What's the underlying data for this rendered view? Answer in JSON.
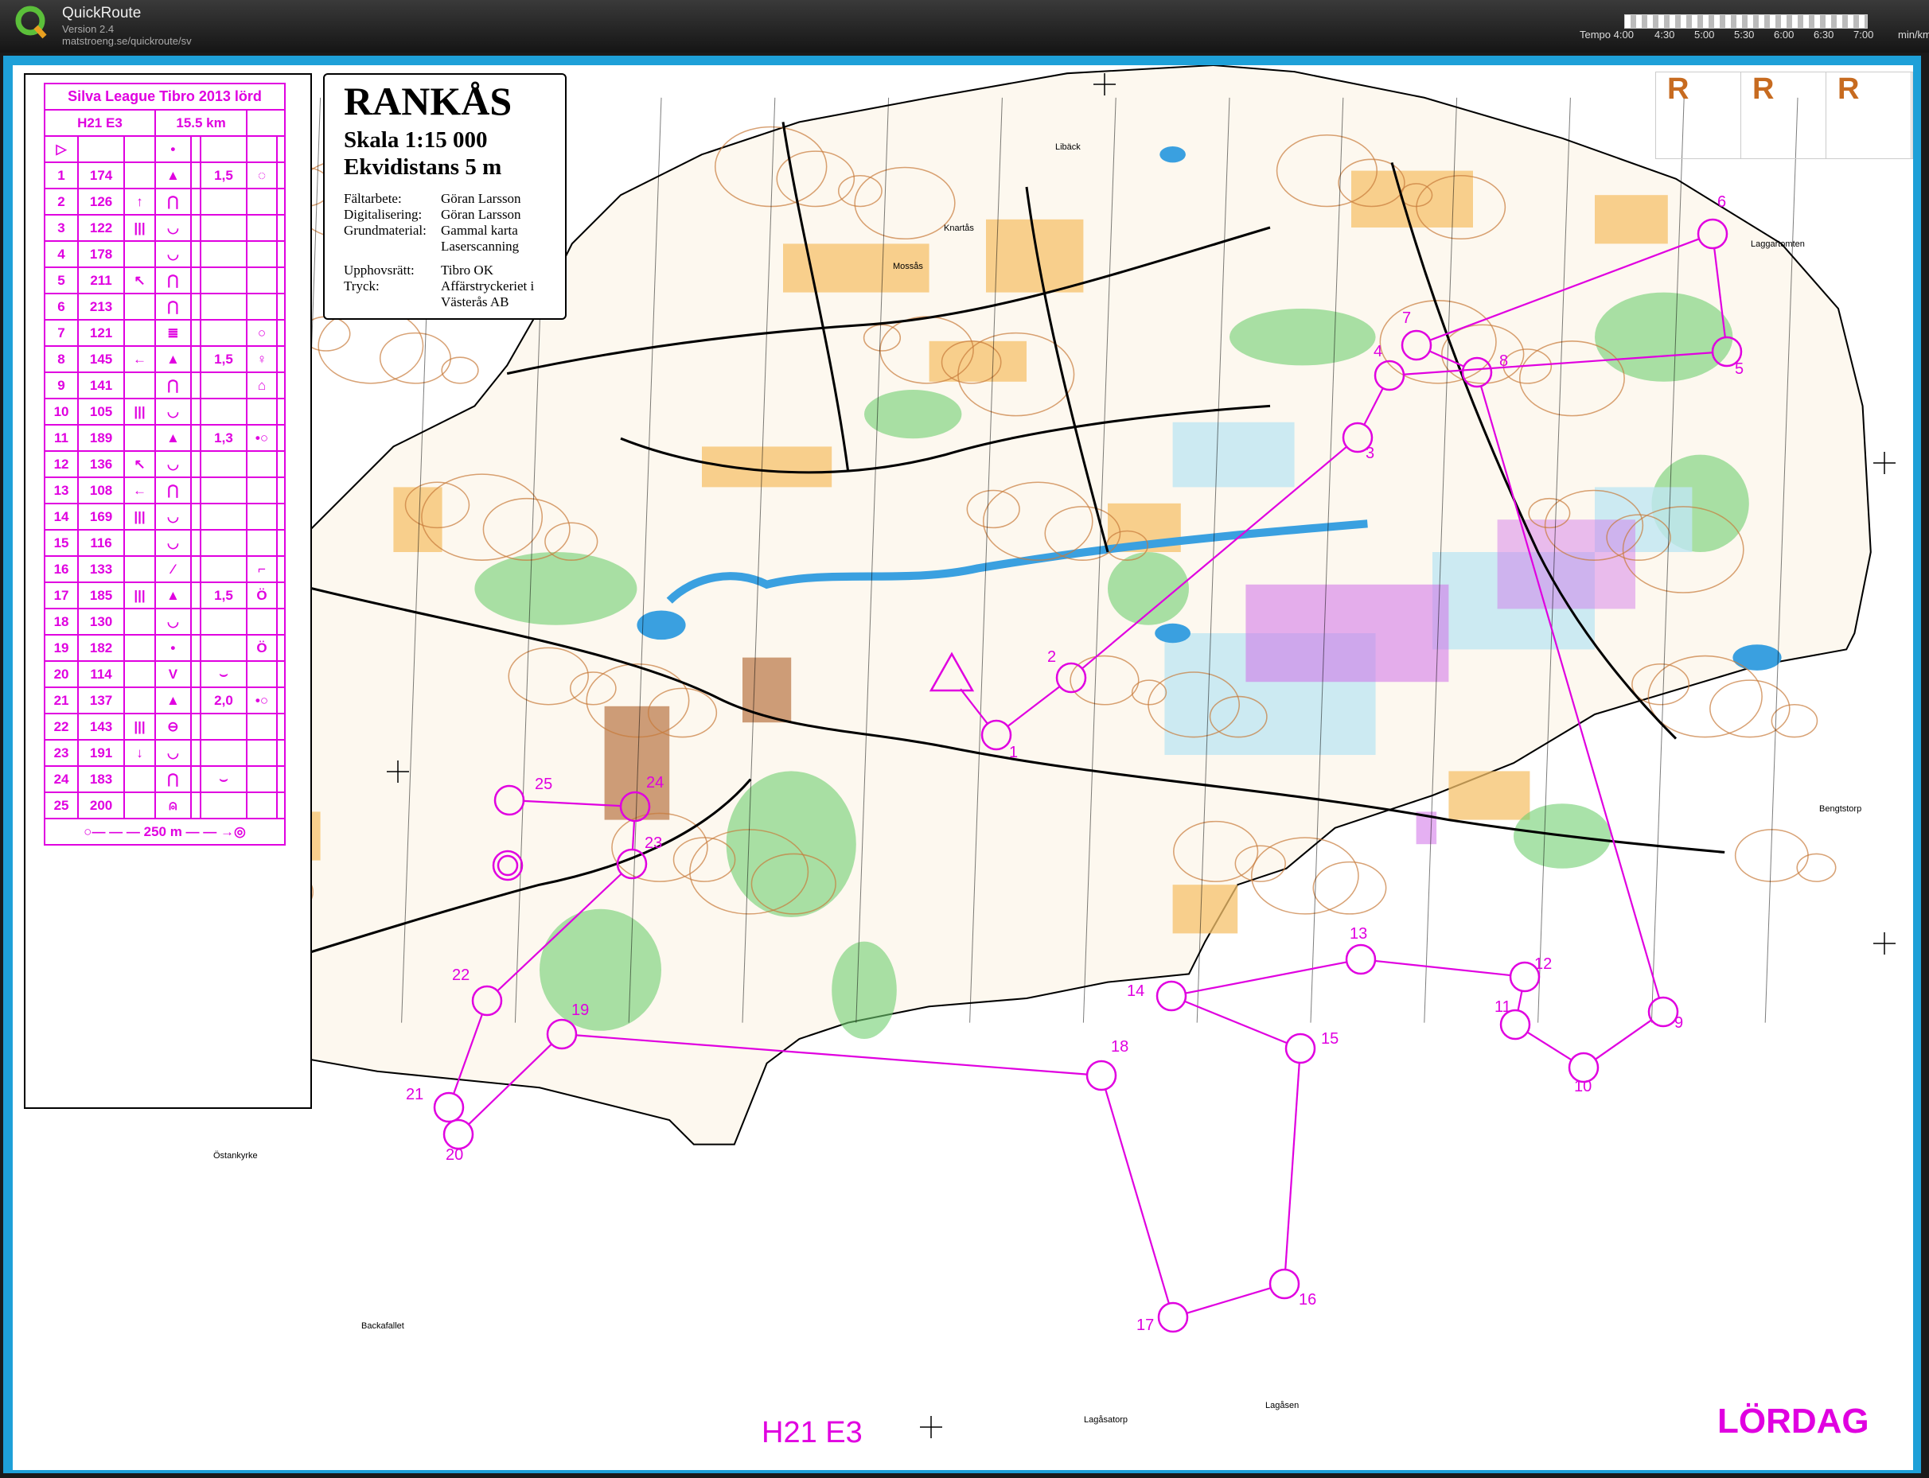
{
  "app": {
    "title": "QuickRoute",
    "version": "Version 2.4",
    "url": "matstroeng.se/quickroute/sv",
    "tempo_labels": [
      "Tempo 4:00",
      "4:30",
      "5:00",
      "5:30",
      "6:00",
      "6:30",
      "7:00",
      "min/km"
    ]
  },
  "map": {
    "title": "RANKÅS",
    "scale": "Skala 1:15 000",
    "contour": "Ekvidistans 5 m",
    "credits": [
      {
        "label": "Fältarbete:",
        "value": "Göran Larsson"
      },
      {
        "label": "Digitalisering:",
        "value": "Göran Larsson"
      },
      {
        "label": "Grundmaterial:",
        "value": "Gammal karta Laserscanning"
      },
      {
        "label": "Upphovsrätt:",
        "value": "Tibro OK"
      },
      {
        "label": "Tryck:",
        "value": "Affärstryckeriet i Västerås AB"
      }
    ],
    "class_label": "H21 E3",
    "day_label": "LÖRDAG",
    "r_marks": [
      "R",
      "R",
      "R"
    ],
    "place_names": [
      "Libäck",
      "Knartås",
      "Mossås",
      "Laggartomten",
      "Bengtstorp",
      "Östankyrke",
      "Backafallet",
      "Lagåsatorp",
      "Lagåsen"
    ],
    "colors": {
      "course": "#e000e0",
      "forest_open": "#f5c26b",
      "green": "#6fce6f",
      "water": "#3aa0e0",
      "contour": "#c87a3a",
      "frame": "#1ea0d8"
    }
  },
  "control_description": {
    "event": "Silva League Tibro 2013 lörd",
    "class": "H21 E3",
    "length": "15.5 km",
    "rows": [
      {
        "n": "1",
        "code": "174",
        "dir": "",
        "feature": "▲",
        "dim": "1,5",
        "extra": "◌"
      },
      {
        "n": "2",
        "code": "126",
        "dir": "↑",
        "feature": "⋂",
        "dim": "",
        "extra": ""
      },
      {
        "n": "3",
        "code": "122",
        "dir": "|||",
        "feature": "◡",
        "dim": "",
        "extra": ""
      },
      {
        "n": "4",
        "code": "178",
        "dir": "",
        "feature": "◡",
        "dim": "",
        "extra": ""
      },
      {
        "n": "5",
        "code": "211",
        "dir": "↖",
        "feature": "⋂",
        "dim": "",
        "extra": ""
      },
      {
        "n": "6",
        "code": "213",
        "dir": "",
        "feature": "⋂",
        "dim": "",
        "extra": ""
      },
      {
        "n": "7",
        "code": "121",
        "dir": "",
        "feature": "≣",
        "dim": "",
        "extra": "○"
      },
      {
        "n": "8",
        "code": "145",
        "dir": "←",
        "feature": "▲",
        "dim": "1,5",
        "extra": "♀"
      },
      {
        "n": "9",
        "code": "141",
        "dir": "",
        "feature": "⋂",
        "dim": "",
        "extra": "⌂"
      },
      {
        "n": "10",
        "code": "105",
        "dir": "|||",
        "feature": "◡",
        "dim": "",
        "extra": ""
      },
      {
        "n": "11",
        "code": "189",
        "dir": "",
        "feature": "▲",
        "dim": "1,3",
        "extra": "•○"
      },
      {
        "n": "12",
        "code": "136",
        "dir": "↖",
        "feature": "◡",
        "dim": "",
        "extra": ""
      },
      {
        "n": "13",
        "code": "108",
        "dir": "←",
        "feature": "⋂",
        "dim": "",
        "extra": ""
      },
      {
        "n": "14",
        "code": "169",
        "dir": "|||",
        "feature": "◡",
        "dim": "",
        "extra": ""
      },
      {
        "n": "15",
        "code": "116",
        "dir": "",
        "feature": "◡",
        "dim": "",
        "extra": ""
      },
      {
        "n": "16",
        "code": "133",
        "dir": "",
        "feature": "⁄",
        "dim": "",
        "extra": "⌐"
      },
      {
        "n": "17",
        "code": "185",
        "dir": "|||",
        "feature": "▲",
        "dim": "1,5",
        "extra": "Ö"
      },
      {
        "n": "18",
        "code": "130",
        "dir": "",
        "feature": "◡",
        "dim": "",
        "extra": ""
      },
      {
        "n": "19",
        "code": "182",
        "dir": "",
        "feature": "•",
        "dim": "",
        "extra": "Ö"
      },
      {
        "n": "20",
        "code": "114",
        "dir": "",
        "feature": "V",
        "dim": "⌣",
        "extra": ""
      },
      {
        "n": "21",
        "code": "137",
        "dir": "",
        "feature": "▲",
        "dim": "2,0",
        "extra": "•○"
      },
      {
        "n": "22",
        "code": "143",
        "dir": "|||",
        "feature": "⊖",
        "dim": "",
        "extra": ""
      },
      {
        "n": "23",
        "code": "191",
        "dir": "↓",
        "feature": "◡",
        "dim": "",
        "extra": ""
      },
      {
        "n": "24",
        "code": "183",
        "dir": "",
        "feature": "⋂",
        "dim": "⌣",
        "extra": ""
      },
      {
        "n": "25",
        "code": "200",
        "dir": "",
        "feature": "⍝",
        "dim": "",
        "extra": ""
      }
    ],
    "finish": "250 m"
  },
  "course": {
    "controls": [
      {
        "n": "1"
      },
      {
        "n": "2"
      },
      {
        "n": "3"
      },
      {
        "n": "4"
      },
      {
        "n": "5"
      },
      {
        "n": "6"
      },
      {
        "n": "7"
      },
      {
        "n": "8"
      },
      {
        "n": "9"
      },
      {
        "n": "10"
      },
      {
        "n": "11"
      },
      {
        "n": "12"
      },
      {
        "n": "13"
      },
      {
        "n": "14"
      },
      {
        "n": "15"
      },
      {
        "n": "16"
      },
      {
        "n": "17"
      },
      {
        "n": "18"
      },
      {
        "n": "19"
      },
      {
        "n": "20"
      },
      {
        "n": "21"
      },
      {
        "n": "22"
      },
      {
        "n": "23"
      },
      {
        "n": "24"
      },
      {
        "n": "25"
      }
    ]
  }
}
